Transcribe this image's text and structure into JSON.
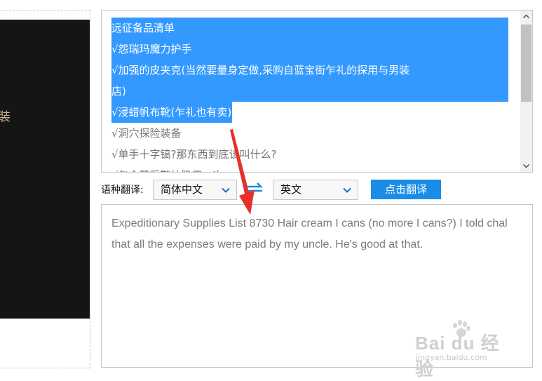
{
  "left_panel": {
    "partial_char": "装"
  },
  "source_text": {
    "lines": [
      {
        "text": "远征备品清单",
        "selected": true,
        "full": true
      },
      {
        "text": "√怨瑞玛魔力护手",
        "selected": true,
        "full": true
      },
      {
        "text": "√加强的皮夹克(当然要量身定做,采购自蓝宝街乍礼的探用与男装",
        "selected": true,
        "full": true
      },
      {
        "text": "店)",
        "selected": true,
        "full": true
      },
      {
        "text": "√浸蜡帆布靴(乍礼也有卖)",
        "selected": true,
        "full": false
      },
      {
        "text": "√洞穴探险装备",
        "selected": false,
        "full": false
      },
      {
        "text": "√单手十字镐?那东西到底该叫什么?",
        "selected": false,
        "full": false
      },
      {
        "text": "√包含蓝采鞋拉隐用一次",
        "selected": false,
        "full": false
      }
    ]
  },
  "toolbar": {
    "lang_label": "语种翻译:",
    "source_lang": "简体中文",
    "target_lang": "英文",
    "translate_button": "点击翻译"
  },
  "output": {
    "text": "Expeditionary Supplies List 8730 Hair cream I cans (no more I cans?) I told chal that all the expenses were paid by my uncle. He's good at that."
  },
  "watermark": {
    "main": "Bai du 经验",
    "sub": "jingyan.baidu.com"
  },
  "colors": {
    "selection": "#3399ff",
    "button": "#1a8ee6",
    "arrow": "#e8302a"
  }
}
